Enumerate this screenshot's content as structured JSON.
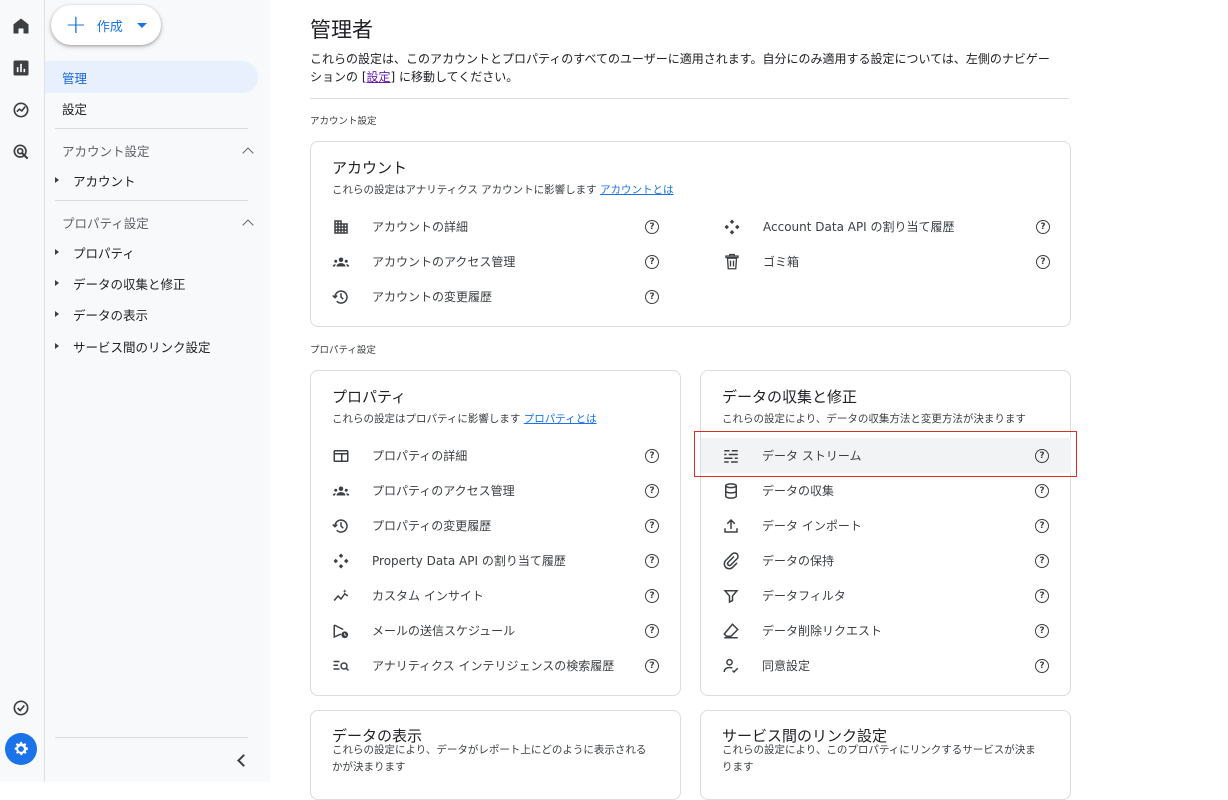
{
  "rail": {
    "icons": [
      "home-icon",
      "reports-icon",
      "explore-icon",
      "advertising-icon",
      "check-circle-icon",
      "gear-icon"
    ]
  },
  "create_button": {
    "label": "作成"
  },
  "nav": {
    "admin": "管理",
    "settings": "設定",
    "account_section": "アカウント設定",
    "account": "アカウント",
    "property_section": "プロパティ設定",
    "property_items": [
      "プロパティ",
      "データの収集と修正",
      "データの表示",
      "サービス間のリンク設定"
    ]
  },
  "page": {
    "title": "管理者",
    "desc_part1": "これらの設定は、このアカウントとプロパティのすべてのユーザーに適用されます。自分にのみ適用する設定については、左側のナビゲーションの [",
    "desc_link": "設定",
    "desc_part2": "] に移動してください。",
    "account_settings_label": "アカウント設定",
    "property_settings_label": "プロパティ設定"
  },
  "account_card": {
    "title": "アカウント",
    "desc": "これらの設定はアナリティクス アカウントに影響します",
    "desc_link": "アカウントとは",
    "left_items": [
      {
        "label": "アカウントの詳細",
        "icon": "building-icon"
      },
      {
        "label": "アカウントのアクセス管理",
        "icon": "people-icon"
      },
      {
        "label": "アカウントの変更履歴",
        "icon": "history-icon"
      }
    ],
    "right_items": [
      {
        "label": "Account Data API の割り当て履歴",
        "icon": "api-icon"
      },
      {
        "label": "ゴミ箱",
        "icon": "trash-icon"
      }
    ]
  },
  "property_card": {
    "title": "プロパティ",
    "desc": "これらの設定はプロパティに影響します",
    "desc_link": "プロパティとは",
    "items": [
      {
        "label": "プロパティの詳細",
        "icon": "property-details-icon"
      },
      {
        "label": "プロパティのアクセス管理",
        "icon": "people-icon"
      },
      {
        "label": "プロパティの変更履歴",
        "icon": "history-icon"
      },
      {
        "label": "Property Data API の割り当て履歴",
        "icon": "api-icon"
      },
      {
        "label": "カスタム インサイト",
        "icon": "insights-icon"
      },
      {
        "label": "メールの送信スケジュール",
        "icon": "schedule-send-icon"
      },
      {
        "label": "アナリティクス インテリジェンスの検索履歴",
        "icon": "search-history-icon"
      }
    ]
  },
  "data_card": {
    "title": "データの収集と修正",
    "desc": "これらの設定により、データの収集方法と変更方法が決まります",
    "items": [
      {
        "label": "データ ストリーム",
        "icon": "data-stream-icon"
      },
      {
        "label": "データの収集",
        "icon": "database-icon"
      },
      {
        "label": "データ インポート",
        "icon": "upload-icon"
      },
      {
        "label": "データの保持",
        "icon": "attach-icon"
      },
      {
        "label": "データフィルタ",
        "icon": "filter-icon"
      },
      {
        "label": "データ削除リクエスト",
        "icon": "eraser-icon"
      },
      {
        "label": "同意設定",
        "icon": "consent-icon"
      }
    ]
  },
  "display_card": {
    "title": "データの表示",
    "desc": "これらの設定により、データがレポート上にどのように表示されるかが決まります"
  },
  "link_card": {
    "title": "サービス間のリンク設定",
    "desc": "これらの設定により、このプロパティにリンクするサービスが決まります"
  },
  "help_glyph": "?",
  "colors": {
    "accent": "#1a73e8",
    "highlight_border": "#d93025",
    "active_nav_bg": "#e8f0fe"
  }
}
